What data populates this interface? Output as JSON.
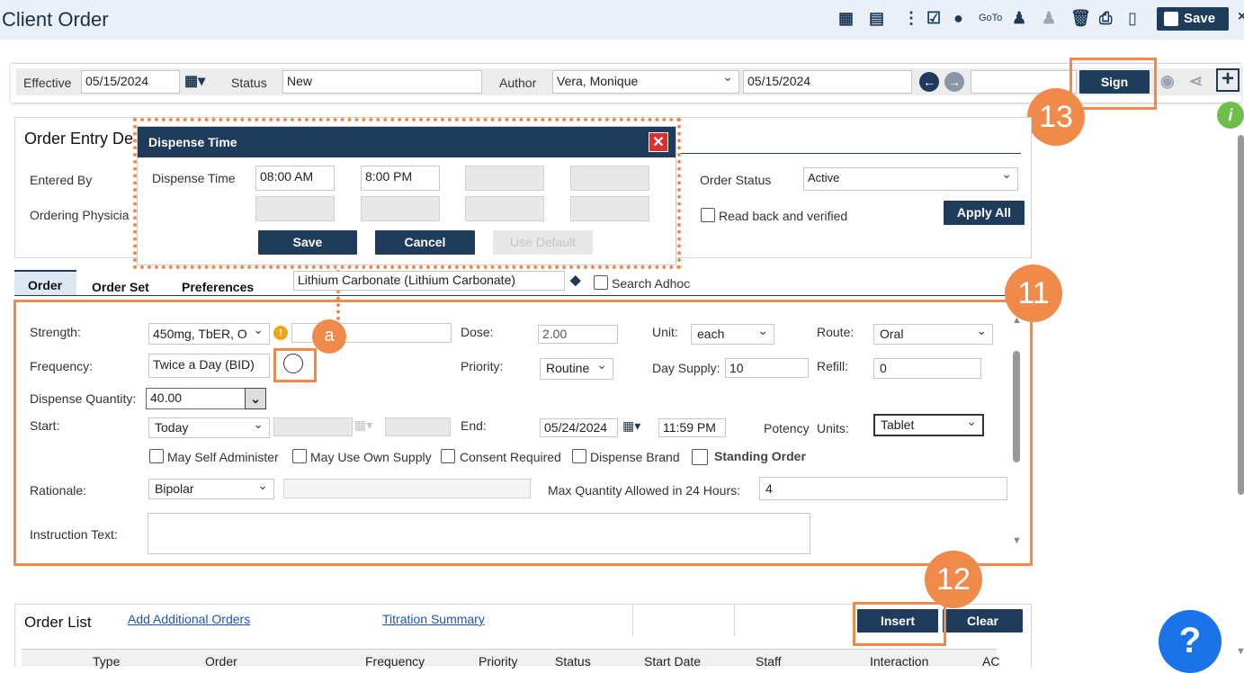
{
  "header": {
    "title": "Client Order",
    "goto_label": "GoTo",
    "save_label": "Save",
    "icons": [
      "calendar-icon",
      "notes-add-icon",
      "more-vertical-icon",
      "clipboard-check-icon",
      "user-circle-icon",
      "user-icon",
      "user-edit-icon",
      "trash-icon",
      "print-icon",
      "document-icon",
      "close-icon"
    ]
  },
  "toolbar": {
    "effective_label": "Effective",
    "effective_value": "05/15/2024",
    "status_label": "Status",
    "status_value": "New",
    "author_label": "Author",
    "author_value": "Vera, Monique",
    "date_value": "05/15/2024",
    "sign_label": "Sign"
  },
  "order_entry": {
    "title": "Order Entry De",
    "entered_by_label": "Entered By",
    "ordering_physician_label": "Ordering Physicia",
    "order_status_label": "Order Status",
    "order_status_value": "Active",
    "read_back_label": "Read back and verified",
    "apply_all_label": "Apply All"
  },
  "dispense_modal": {
    "title": "Dispense Time",
    "field_label": "Dispense Time",
    "times": [
      "08:00 AM",
      "8:00 PM",
      "",
      "",
      "",
      "",
      "",
      ""
    ],
    "save_label": "Save",
    "cancel_label": "Cancel",
    "use_default_label": "Use Default"
  },
  "tabs": [
    "Order",
    "Order Set",
    "Preferences"
  ],
  "search": {
    "value": "Lithium Carbonate (Lithium Carbonate)",
    "adhoc_label": "Search Adhoc"
  },
  "order_form": {
    "strength_label": "Strength:",
    "strength_value": "450mg, TbER, O",
    "dose_label": "Dose:",
    "dose_value": "2.00",
    "unit_label": "Unit:",
    "unit_value": "each",
    "route_label": "Route:",
    "route_value": "Oral",
    "frequency_label": "Frequency:",
    "frequency_value": "Twice a Day (BID)",
    "priority_label": "Priority:",
    "priority_value": "Routine",
    "day_supply_label": "Day Supply:",
    "day_supply_value": "10",
    "refill_label": "Refill:",
    "refill_value": "0",
    "dispense_qty_label": "Dispense Quantity:",
    "dispense_qty_value": "40.00",
    "start_label": "Start:",
    "start_value": "Today",
    "end_label": "End:",
    "end_date": "05/24/2024",
    "end_time": "11:59 PM",
    "potency_label": "Potency",
    "units_label": "Units:",
    "units_value": "Tablet",
    "checkboxes": [
      "May Self Administer",
      "May Use Own Supply",
      "Consent Required",
      "Dispense Brand",
      "Standing Order"
    ],
    "rationale_label": "Rationale:",
    "rationale_value": "Bipolar",
    "max_qty_label": "Max Quantity Allowed in 24 Hours:",
    "max_qty_value": "4",
    "instruction_label": "Instruction Text:"
  },
  "order_list": {
    "title": "Order List",
    "add_link": "Add Additional Orders",
    "titration_link": "Titration Summary",
    "insert_label": "Insert",
    "clear_label": "Clear",
    "columns": [
      "Type",
      "Order",
      "Frequency",
      "Priority",
      "Status",
      "Start Date",
      "Staff",
      "Interaction",
      "AC"
    ]
  },
  "callouts": [
    "13",
    "11",
    "a",
    "12"
  ],
  "help_label": "?",
  "colors": {
    "accent": "#1f3d5a",
    "callout": "#f08a4b"
  }
}
